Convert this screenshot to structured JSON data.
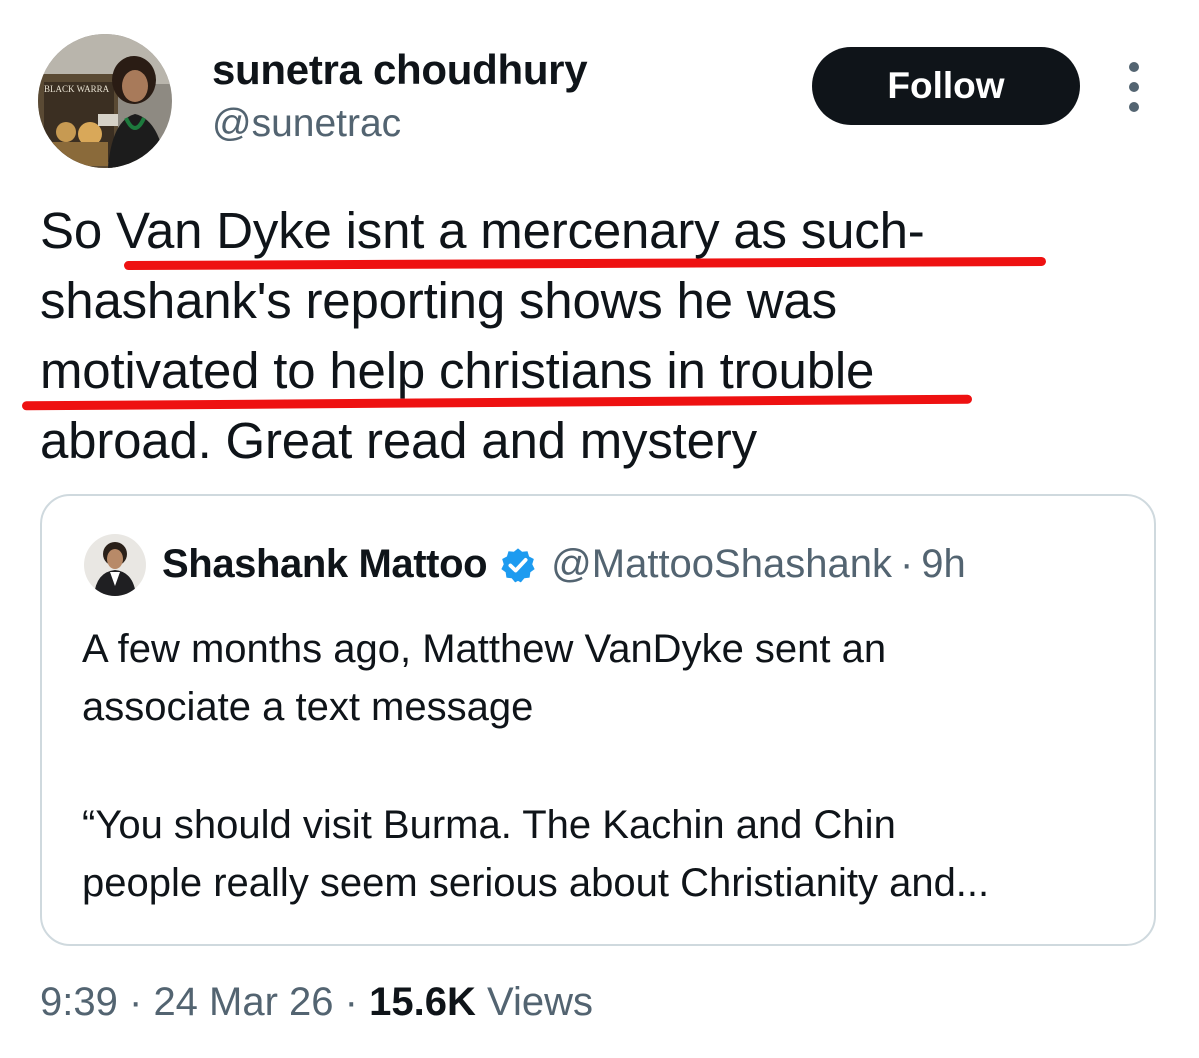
{
  "author": {
    "name": "sunetra choudhury",
    "handle": "@sunetrac",
    "avatar_poster_text": "BLACK WARRA"
  },
  "header": {
    "follow_label": "Follow",
    "more_icon": "more-vertical-icon"
  },
  "tweet": {
    "lines": [
      "So Van Dyke isnt a mercenary as such-",
      "shashank's reporting shows he was",
      "motivated to help christians in trouble",
      "abroad. Great read and mystery"
    ],
    "highlight_color": "#ee1111"
  },
  "quote": {
    "name": "Shashank Mattoo",
    "verified_icon": "verified-badge-icon",
    "handle": "@MattooShashank",
    "separator": "·",
    "time": "9h",
    "paragraph1": [
      "A few months ago, Matthew VanDyke sent an",
      "associate a text message"
    ],
    "paragraph2": [
      "“You should visit Burma. The Kachin and Chin",
      "people really seem serious about Christianity and..."
    ]
  },
  "meta": {
    "time": "9:39",
    "sep1": "·",
    "date": "24 Mar 26",
    "sep2": "·",
    "views_count": "15.6K",
    "views_label": "Views"
  },
  "colors": {
    "text": "#0f1419",
    "secondary": "#536471",
    "border": "#cfd9de",
    "verified": "#1d9bf0",
    "button_bg": "#0f1419"
  }
}
